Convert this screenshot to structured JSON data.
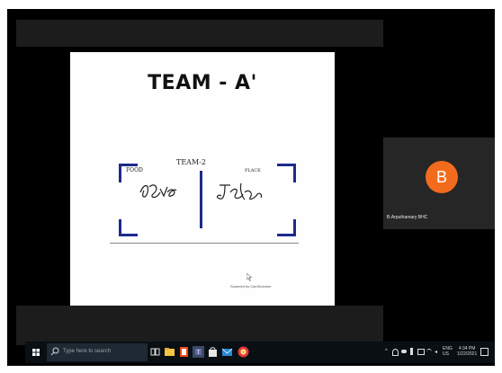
{
  "slide": {
    "title": "TEAM - A'",
    "paper_heading": "TEAM-2",
    "left_label": "FOOD",
    "right_label": "PLACE",
    "caption": "Scanned by CamScanner"
  },
  "participant": {
    "initial": "B",
    "name": "B.Arputhamary BHC",
    "avatar_color": "#f26b1d"
  },
  "taskbar": {
    "search_placeholder": "Type here to search",
    "apps": [
      "task-view-icon",
      "file-explorer-icon",
      "office-icon",
      "teams-icon",
      "store-icon",
      "mail-icon",
      "chrome-icon"
    ],
    "language": "ENG",
    "region": "US",
    "time": "4:34 PM",
    "date": "1/22/2021"
  }
}
